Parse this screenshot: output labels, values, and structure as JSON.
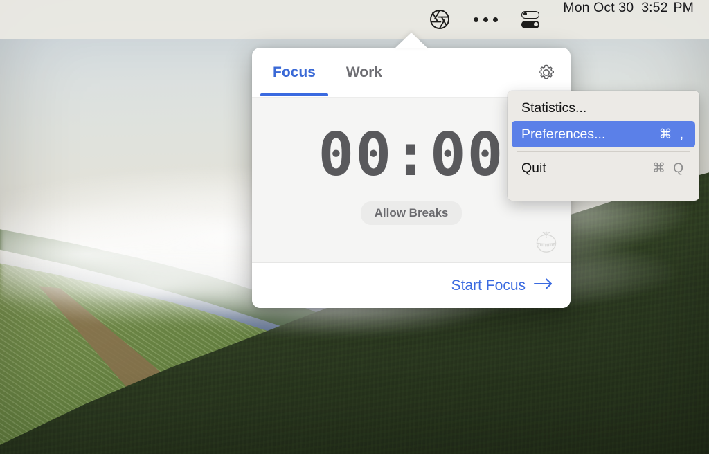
{
  "menubar": {
    "icons": [
      {
        "name": "aperture-icon",
        "label": "Aperture"
      },
      {
        "name": "more-icon",
        "label": "•••"
      },
      {
        "name": "control-center-icon",
        "label": "Control Center"
      }
    ],
    "clock": {
      "date": "Mon Oct 30",
      "time": "3:52",
      "ampm": "PM"
    },
    "background_color": "#e9e8e2"
  },
  "popover": {
    "tabs": [
      {
        "label": "Focus",
        "active": true,
        "name": "tab-focus"
      },
      {
        "label": "Work",
        "active": false,
        "name": "tab-work"
      }
    ],
    "gear_icon": "gear-icon",
    "timer": "00:00",
    "allow_breaks_label": "Allow Breaks",
    "pomodoro_icon": "tomato-timer-icon",
    "footer": {
      "start_label": "Start Focus",
      "arrow_icon": "arrow-right-icon"
    },
    "accent_color": "#3a6ae0",
    "body_color": "#f5f5f4"
  },
  "settings_menu": {
    "items": [
      {
        "label": "Statistics...",
        "shortcut": "",
        "highlighted": false,
        "name": "menu-item-statistics"
      },
      {
        "label": "Preferences...",
        "shortcut": "⌘ ,",
        "highlighted": true,
        "name": "menu-item-preferences"
      },
      {
        "label": "Quit",
        "shortcut": "⌘ Q",
        "highlighted": false,
        "name": "menu-item-quit"
      }
    ],
    "highlight_color": "#5b80e8",
    "background_color": "#eceae6"
  },
  "wallpaper": {
    "description": "Misty forested hills with vineyard",
    "sky_color": "#dfe2dd",
    "ridge_color": "#3e5a8c",
    "forest_color": "#2c3a21",
    "vineyard_color": "#96a85c"
  }
}
